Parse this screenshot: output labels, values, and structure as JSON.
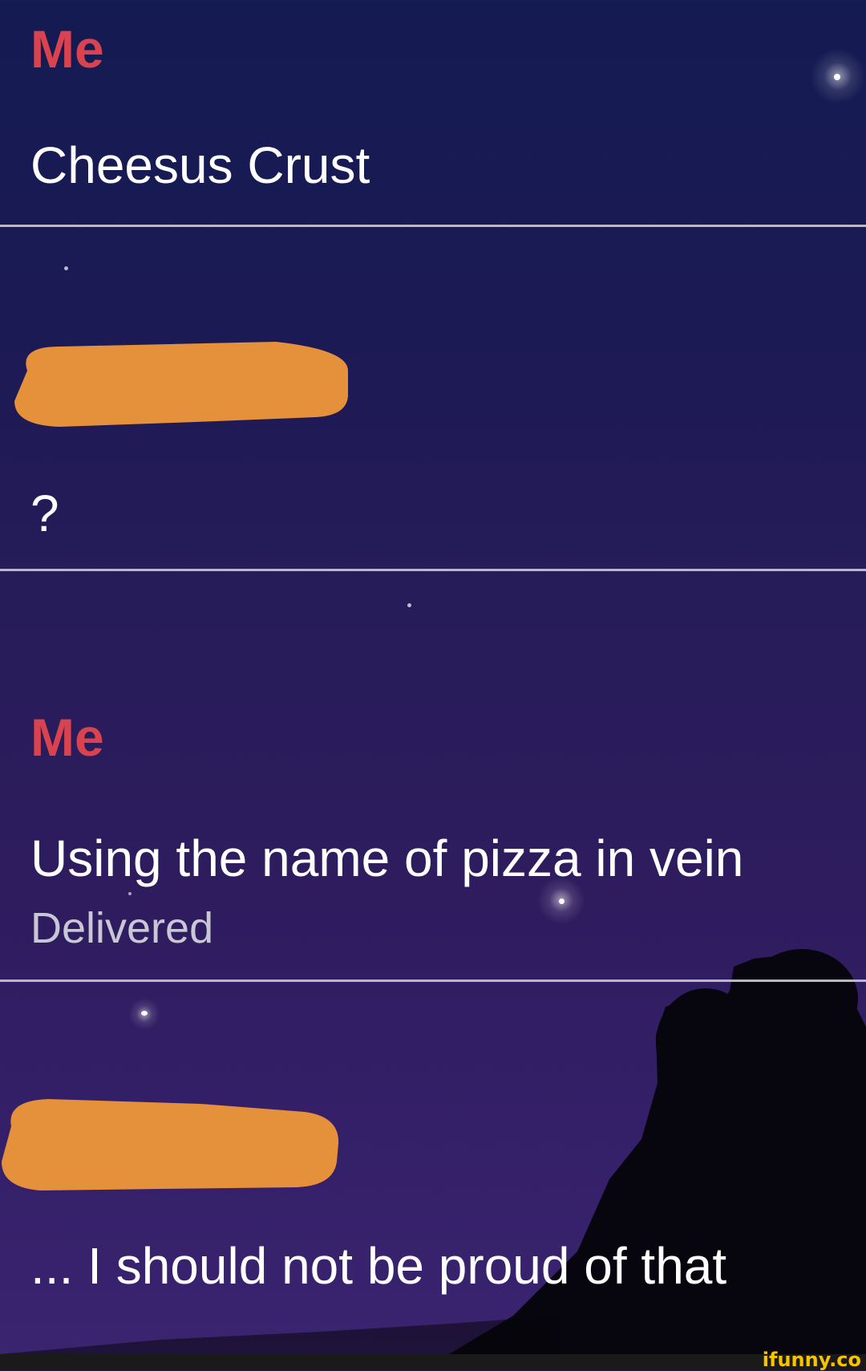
{
  "conversation": {
    "messages": [
      {
        "sender": "Me",
        "text": "Cheesus Crust"
      },
      {
        "sender_redacted": true,
        "text": "?"
      },
      {
        "sender": "Me",
        "text": "Using the name of pizza in vein",
        "status": "Delivered"
      },
      {
        "sender_redacted": true,
        "text": "... I should not be proud of that"
      }
    ]
  },
  "colors": {
    "sender_name": "#d8434f",
    "message_text": "#ffffff",
    "status_text": "#c9c6d6",
    "divider": "#b9b7c8",
    "redaction": "#e5903a",
    "background_top": "#141b52",
    "background_bottom": "#3b2470",
    "watermark": "#f5c300"
  },
  "watermark": {
    "label": "ifunny.co"
  }
}
